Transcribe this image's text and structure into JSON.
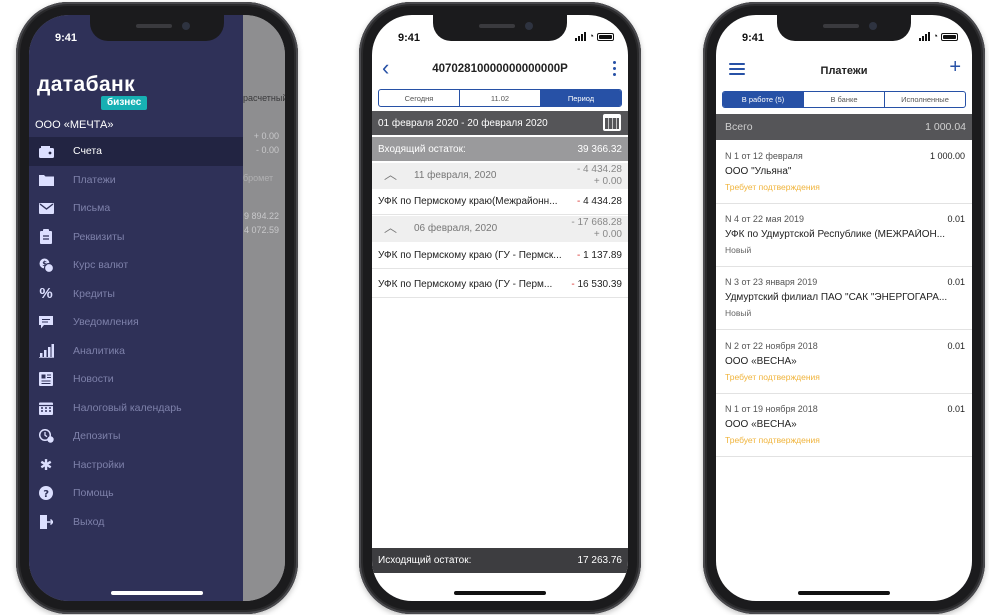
{
  "status_bar": {
    "time": "9:41"
  },
  "colors": {
    "drawer_bg": "#2f3158",
    "active_item_bg": "#222442",
    "brand_accent": "#17b0b3",
    "primary_blue": "#2751a6",
    "negative_amount": "#d8322e",
    "status_pending": "#f0b43c",
    "status_new": "#666666"
  },
  "phone1": {
    "brand": {
      "logo": "датабанк",
      "tag": "бизнес"
    },
    "company": "ООО «МЕЧТА»",
    "menu": [
      {
        "label": "Счета",
        "icon": "wallet-icon"
      },
      {
        "label": "Платежи",
        "icon": "folder-icon"
      },
      {
        "label": "Письма",
        "icon": "envelope-icon"
      },
      {
        "label": "Реквизиты",
        "icon": "clipboard-icon"
      },
      {
        "label": "Курс валют",
        "icon": "currency-exchange-icon"
      },
      {
        "label": "Кредиты",
        "icon": "percent-icon"
      },
      {
        "label": "Уведомления",
        "icon": "chat-bubble-icon"
      },
      {
        "label": "Аналитика",
        "icon": "bar-chart-icon"
      },
      {
        "label": "Новости",
        "icon": "newspaper-icon"
      },
      {
        "label": "Налоговый календарь",
        "icon": "calendar-icon"
      },
      {
        "label": "Депозиты",
        "icon": "deposit-clock-icon"
      },
      {
        "label": "Настройки",
        "icon": "gear-icon"
      },
      {
        "label": "Помощь",
        "icon": "help-icon"
      },
      {
        "label": "Выход",
        "icon": "logout-icon"
      }
    ],
    "background": {
      "header": "расчетный",
      "values": [
        "+ 0.00",
        "- 0.00",
        "9 894.22",
        "4 072.59"
      ],
      "label": "бромет"
    }
  },
  "phone2": {
    "title": "40702810000000000000Р",
    "tabs": [
      "Сегодня",
      "11.02",
      "Период"
    ],
    "date_range": "01 февраля 2020 - 20 февраля 2020",
    "opening": {
      "label": "Входящий остаток:",
      "value": "39 366.32"
    },
    "groups": [
      {
        "date": "11 февраля, 2020",
        "debit": "- 4 434.28",
        "credit": "+ 0.00",
        "rows": [
          {
            "name": "УФК по Пермскому краю(Межрайонн...",
            "amount": "4 434.28"
          }
        ]
      },
      {
        "date": "06 февраля, 2020",
        "debit": "- 17 668.28",
        "credit": "+ 0.00",
        "rows": [
          {
            "name": "УФК по Пермскому краю (ГУ - Пермск...",
            "amount": "1 137.89"
          },
          {
            "name": "УФК по Пермскому краю (ГУ - Перм...",
            "amount": "16 530.39"
          }
        ]
      }
    ],
    "closing": {
      "label": "Исходящий остаток:",
      "value": "17 263.76"
    }
  },
  "phone3": {
    "title": "Платежи",
    "tabs": [
      "В работе (5)",
      "В банке",
      "Исполненные"
    ],
    "total": {
      "label": "Всего",
      "value": "1 000.04"
    },
    "payments": [
      {
        "number": "N 1 от 12 февраля",
        "amount": "1 000.00",
        "payee": "ООО \"Ульяна\"",
        "status": "Требует подтверждения",
        "status_type": "pending"
      },
      {
        "number": "N 4 от 22 мая 2019",
        "amount": "0.01",
        "payee": "УФК по Удмуртской Республике (МЕЖРАЙОН...",
        "status": "Новый",
        "status_type": "new"
      },
      {
        "number": "N 3 от 23 января 2019",
        "amount": "0.01",
        "payee": "Удмуртский филиал ПАО \"САК \"ЭНЕРГОГАРА...",
        "status": "Новый",
        "status_type": "new"
      },
      {
        "number": "N 2 от 22 ноября 2018",
        "amount": "0.01",
        "payee": "ООО «ВЕСНА»",
        "status": "Требует подтверждения",
        "status_type": "pending"
      },
      {
        "number": "N 1 от 19 ноября 2018",
        "amount": "0.01",
        "payee": "ООО «ВЕСНА»",
        "status": "Требует подтверждения",
        "status_type": "pending"
      }
    ]
  }
}
